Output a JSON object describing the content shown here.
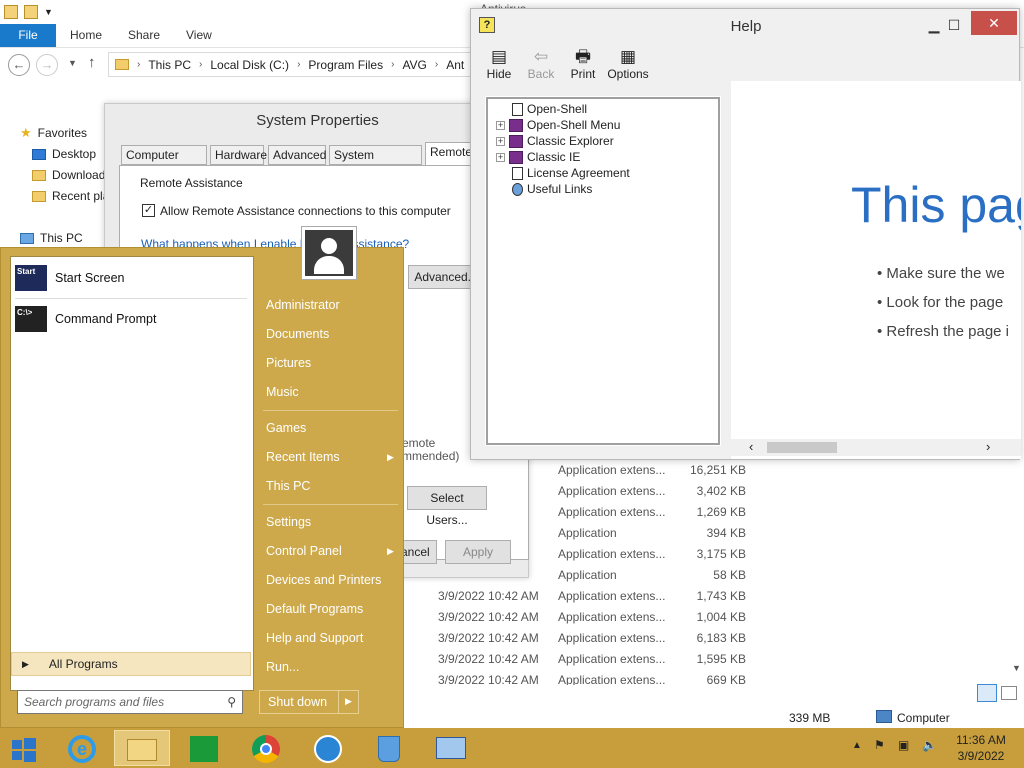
{
  "explorer": {
    "tabs": {
      "file": "File",
      "home": "Home",
      "share": "Share",
      "view": "View"
    },
    "breadcrumb": [
      "This PC",
      "Local Disk (C:)",
      "Program Files",
      "AVG",
      "Ant"
    ],
    "nav": {
      "favorites": "Favorites",
      "desktop": "Desktop",
      "downloads": "Download",
      "recent": "Recent pla",
      "thispc": "This PC"
    },
    "background_title": "Antivirus",
    "files": [
      {
        "date": "",
        "type": "Application extens...",
        "size": "16,251 KB"
      },
      {
        "date": "",
        "type": "Application extens...",
        "size": "3,402 KB"
      },
      {
        "date": "",
        "type": "Application extens...",
        "size": "1,269 KB"
      },
      {
        "date": "",
        "type": "Application",
        "size": "394 KB"
      },
      {
        "date": "",
        "type": "Application extens...",
        "size": "3,175 KB"
      },
      {
        "date": "",
        "type": "Application",
        "size": "58 KB"
      },
      {
        "date": "3/9/2022 10:42 AM",
        "type": "Application extens...",
        "size": "1,743 KB"
      },
      {
        "date": "3/9/2022 10:42 AM",
        "type": "Application extens...",
        "size": "1,004 KB"
      },
      {
        "date": "3/9/2022 10:42 AM",
        "type": "Application extens...",
        "size": "6,183 KB"
      },
      {
        "date": "3/9/2022 10:42 AM",
        "type": "Application extens...",
        "size": "1,595 KB"
      },
      {
        "date": "3/9/2022 10:42 AM",
        "type": "Application extens...",
        "size": "669 KB"
      }
    ],
    "status": {
      "size": "339 MB",
      "location": "Computer"
    }
  },
  "sysprops": {
    "title": "System Properties",
    "tabs": [
      "Computer Name",
      "Hardware",
      "Advanced",
      "System Protection",
      "Remote"
    ],
    "group": "Remote Assistance",
    "checkbox_label": "Allow Remote Assistance connections to this computer",
    "link": "What happens when I enable Remote Assistance?",
    "advanced_btn": "Advanced...",
    "remote_text": "emote",
    "recommended_text": "mmended)",
    "select_users_btn": "Select Users...",
    "cancel_btn": "Cancel",
    "apply_btn": "Apply"
  },
  "help": {
    "title": "Help",
    "toolbar": {
      "hide": "Hide",
      "back": "Back",
      "print": "Print",
      "options": "Options"
    },
    "tree": [
      {
        "label": "Open-Shell",
        "kind": "doc",
        "expandable": false
      },
      {
        "label": "Open-Shell Menu",
        "kind": "book",
        "expandable": true
      },
      {
        "label": "Classic Explorer",
        "kind": "book",
        "expandable": true
      },
      {
        "label": "Classic IE",
        "kind": "book",
        "expandable": true
      },
      {
        "label": "License Agreement",
        "kind": "doc",
        "expandable": false
      },
      {
        "label": "Useful Links",
        "kind": "link",
        "expandable": false
      }
    ],
    "content": {
      "heading": "This pag",
      "bullets": [
        "Make sure the we",
        "Look for the page",
        "Refresh the page i"
      ]
    }
  },
  "startmenu": {
    "pinned": [
      {
        "label": "Start Screen",
        "icon": "Start"
      },
      {
        "label": "Command Prompt",
        "icon": "C:\\>"
      }
    ],
    "all_programs": "All Programs",
    "search_placeholder": "Search programs and files",
    "right": {
      "administrator": "Administrator",
      "documents": "Documents",
      "pictures": "Pictures",
      "music": "Music",
      "games": "Games",
      "recent_items": "Recent Items",
      "this_pc": "This PC",
      "settings": "Settings",
      "control_panel": "Control Panel",
      "devices": "Devices and Printers",
      "default_programs": "Default Programs",
      "help_support": "Help and Support",
      "run": "Run..."
    },
    "shutdown": "Shut down"
  },
  "taskbar": {
    "tasks": [
      "start-button",
      "ie-icon",
      "file-explorer-icon",
      "store-icon",
      "chrome-icon",
      "disk-icon",
      "recycle-icon",
      "control-icon"
    ],
    "clock_time": "11:36 AM",
    "clock_date": "3/9/2022"
  },
  "colors": {
    "startmenu": "#cda94b",
    "taskbar": "#c79e3b",
    "file_tab": "#1979ca",
    "help_close": "#c7504a"
  }
}
